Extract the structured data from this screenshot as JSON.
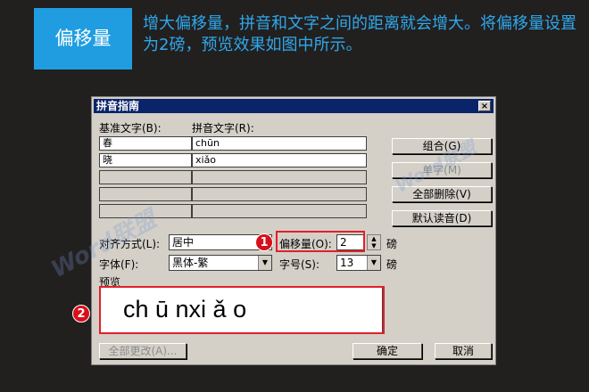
{
  "header": {
    "badge": "偏移量",
    "text": "增大偏移量，拼音和文字之间的距离就会增大。将偏移量设置为2磅，预览效果如图中所示。"
  },
  "dialog": {
    "title": "拼音指南",
    "close_label": "×",
    "base_text_label": "基准文字(B):",
    "pinyin_text_label": "拼音文字(R):",
    "rows": [
      {
        "base": "春",
        "pinyin": "chūn"
      },
      {
        "base": "晓",
        "pinyin": "xiǎo"
      }
    ],
    "buttons": {
      "group": "组合(G)",
      "single": "单字(M)",
      "delete_all": "全部删除(V)",
      "default_reading": "默认读音(D)",
      "change_all": "全部更改(A)...",
      "ok": "确定",
      "cancel": "取消"
    },
    "alignment_label": "对齐方式(L):",
    "alignment_value": "居中",
    "offset_label": "偏移量(O):",
    "offset_value": "2",
    "offset_unit": "磅",
    "font_label": "字体(F):",
    "font_value": "黑体-繁",
    "size_label": "字号(S):",
    "size_value": "13",
    "size_unit": "磅",
    "preview_label": "预览",
    "preview_text": "ch ū nxi ǎ o"
  },
  "callouts": [
    "1",
    "2"
  ],
  "watermark": "Word联盟",
  "colors": {
    "accent": "#1f9de0",
    "callout": "#e0202a"
  }
}
